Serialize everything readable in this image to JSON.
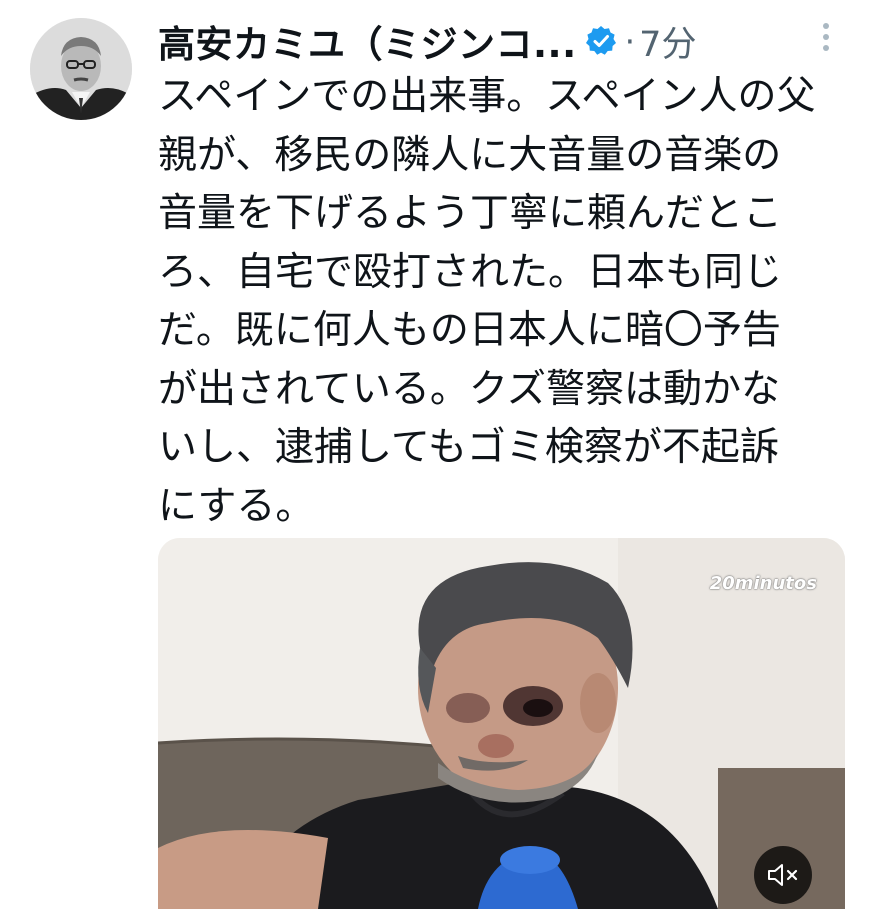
{
  "post": {
    "author": {
      "display_name": "高安カミユ（ミジンコ...",
      "avatar_icon": "user-avatar",
      "verified_badge_icon": "verified-badge-icon",
      "verified_color": "#1d9bf0"
    },
    "dot_separator": "·",
    "timestamp": "7分",
    "more_icon": "more-vertical-icon",
    "text": "スペインでの出来事。スペイン人の父親が、移民の隣人に大音量の音楽の音量を下げるよう丁寧に頼んだところ、自宅で殴打された。日本も同じだ。既に何人もの日本人に暗〇予告が出されている。クズ警察は動かないし、逮捕してもゴミ検察が不起訴にする。",
    "media": {
      "type": "video",
      "watermark": "20minutos",
      "mute_icon": "speaker-muted-icon"
    }
  },
  "colors": {
    "text": "#0f1419",
    "secondary": "#536471",
    "background": "#ffffff"
  }
}
